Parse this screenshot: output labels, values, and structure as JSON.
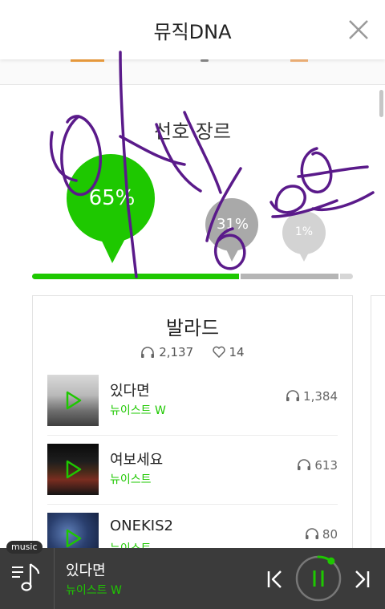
{
  "header": {
    "title": "뮤직DNA"
  },
  "section": {
    "title": "선호 장르"
  },
  "genres": [
    {
      "percent": "65%",
      "color": "#1ec800"
    },
    {
      "percent": "31%",
      "color": "#a9a9a9"
    },
    {
      "percent": "1%",
      "color": "#d3d3d3"
    }
  ],
  "genre_bar": [
    {
      "fraction": 0.65,
      "color": "#1ec800"
    },
    {
      "fraction": 0.31,
      "color": "#b5b5b5"
    },
    {
      "fraction": 0.04,
      "color": "#d6d6d6"
    }
  ],
  "card": {
    "title": "발라드",
    "listens": "2,137",
    "likes": "14",
    "tracks": [
      {
        "title": "있다면",
        "artist": "뉴이스트 W",
        "plays": "1,384"
      },
      {
        "title": "여보세요",
        "artist": "뉴이스트",
        "plays": "613"
      },
      {
        "title": "ONEKIS2",
        "artist": "뉴이스트",
        "plays": "80"
      }
    ]
  },
  "player": {
    "badge": "music",
    "title": "있다면",
    "artist": "뉴이스트 W",
    "progress": 0.1
  },
  "icons": [
    "close-icon",
    "headphones-icon",
    "heart-icon",
    "play-icon",
    "playlist-icon",
    "previous-icon",
    "pause-icon",
    "next-icon"
  ],
  "colors": {
    "accent": "#1ec800",
    "player_bg": "#3b3b3b",
    "scribble": "#5a1a8a"
  }
}
